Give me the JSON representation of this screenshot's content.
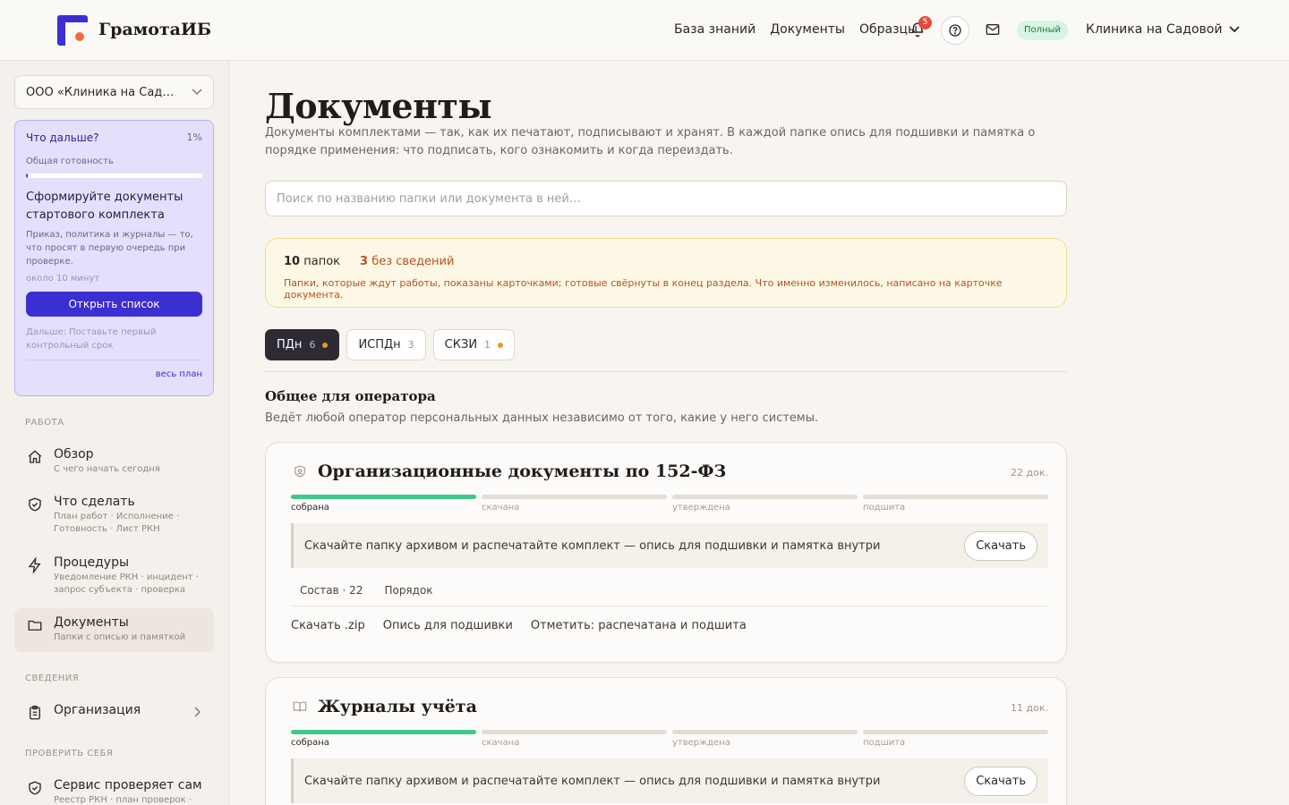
{
  "brand": {
    "name": "ГрамотаИБ",
    "accent": "#3b2fd1",
    "dot": "#f26a3f"
  },
  "header": {
    "nav": [
      "База знаний",
      "Документы",
      "Образцы"
    ],
    "notifications": "5",
    "plan_badge": "Полный",
    "clinic": "Клиника на Садовой",
    "bell_icon": "bell-icon",
    "help_icon": "help-circle-icon",
    "mail_icon": "mail-icon"
  },
  "sidebar": {
    "org": "ООО «Клиника на Садовой»",
    "next": {
      "title": "Что дальше?",
      "percent": "1%",
      "progress": 0.01,
      "readiness_label": "Общая готовность",
      "task_title": "Сформируйте документы стартового комплекта",
      "task_desc": "Приказ, политика и журналы — то, что просят в первую очередь при проверке.",
      "time": "около 10 минут",
      "button": "Открыть список",
      "next_text": "Дальше: Поставьте первый контрольный срок",
      "plan_link": "весь план"
    },
    "sections": {
      "work": "РАБОТА",
      "info": "СВЕДЕНИЯ",
      "check": "ПРОВЕРИТЬ СЕБЯ"
    },
    "items": [
      {
        "title": "Обзор",
        "sub": "С чего начать сегодня",
        "icon": "home-icon"
      },
      {
        "title": "Что сделать",
        "sub": "План работ · Исполнение · Готовность · Лист РКН",
        "icon": "shield-check-icon"
      },
      {
        "title": "Процедуры",
        "sub": "Уведомление РКН · инцидент · запрос субъекта · проверка",
        "icon": "bolt-icon"
      },
      {
        "title": "Документы",
        "sub": "Папки с описью и памяткой",
        "icon": "folder-icon"
      },
      {
        "title": "Организация",
        "sub": "",
        "icon": "clipboard-icon"
      },
      {
        "title": "Сервис проверяет сам",
        "sub": "Реестр РКН · план проверок ·",
        "icon": "shield-check-icon"
      }
    ]
  },
  "main": {
    "title": "Документы",
    "description": "Документы комплектами — так, как их печатают, подписывают и хранят. В каждой папке опись для подшивки и памятка о порядке применения: что подписать, кого ознакомить и когда переиздать.",
    "search_placeholder": "Поиск по названию папки или документа в ней…",
    "summary": {
      "folders_count": "10",
      "folders_label": "папок",
      "missing_count": "3",
      "missing_label": "без сведений",
      "note": "Папки, которые ждут работы, показаны карточками; готовые свёрнуты в конец раздела. Что именно изменилось, написано на карточке документа."
    },
    "tabs": [
      {
        "label": "ПДн",
        "count": "6",
        "dot": true,
        "active": true
      },
      {
        "label": "ИСПДн",
        "count": "3",
        "dot": false,
        "active": false
      },
      {
        "label": "СКЗИ",
        "count": "1",
        "dot": true,
        "active": false
      }
    ],
    "group": {
      "title": "Общее для оператора",
      "description": "Ведёт любой оператор персональных данных независимо от того, какие у него системы."
    },
    "steps": [
      "собрана",
      "скачана",
      "утверждена",
      "подшита"
    ],
    "folders": [
      {
        "title": "Организационные документы по 152-ФЗ",
        "count": "22 док.",
        "icon": "shield-doc-icon",
        "steps_done": 1,
        "cta": "Скачайте папку архивом и распечатайте комплект — опись для подшивки и памятка внутри",
        "button": "Скачать",
        "tabs": [
          "Состав · 22",
          "Порядок"
        ],
        "actions": [
          "Скачать .zip",
          "Опись для подшивки",
          "Отметить: распечатана и подшита"
        ]
      },
      {
        "title": "Журналы учёта",
        "count": "11 док.",
        "icon": "book-icon",
        "steps_done": 1,
        "cta": "Скачайте папку архивом и распечатайте комплект — опись для подшивки и памятка внутри",
        "button": "Скачать"
      }
    ]
  }
}
